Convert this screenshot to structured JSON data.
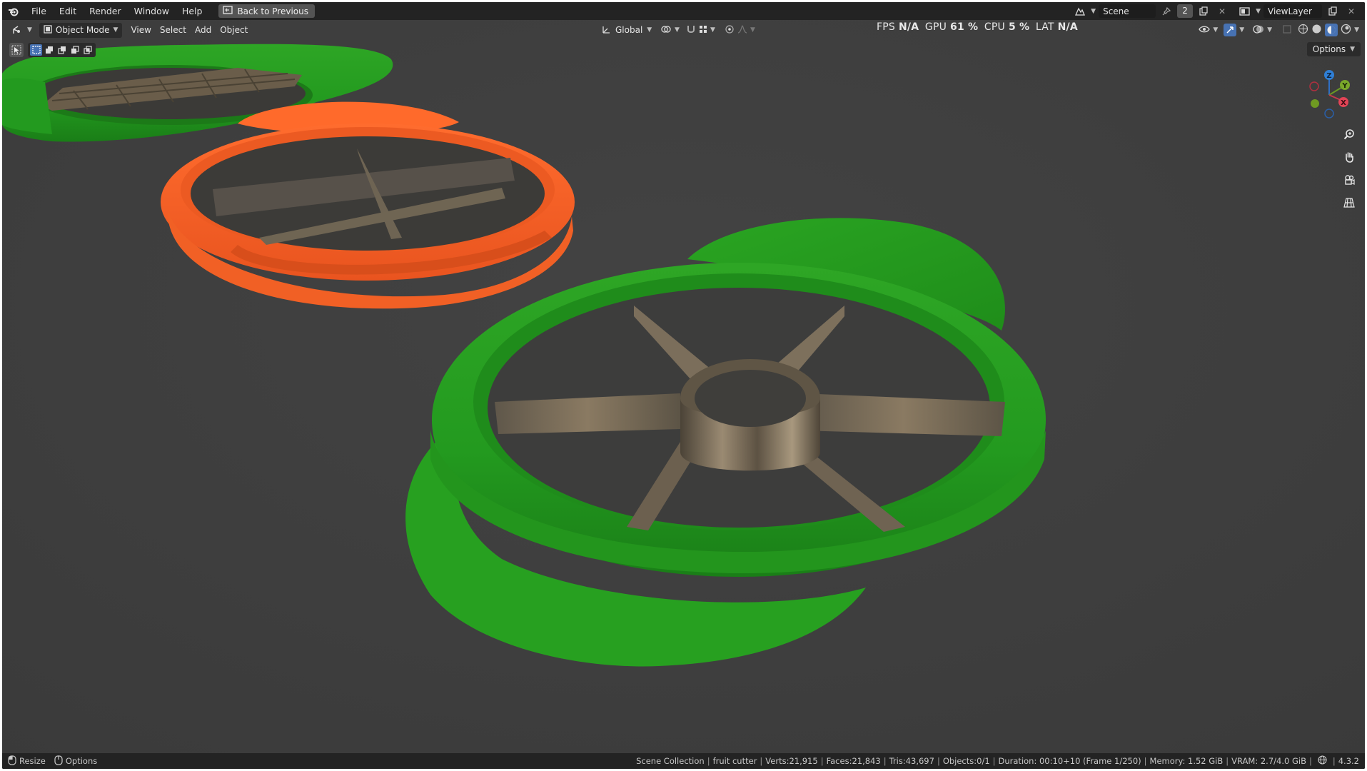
{
  "menu": {
    "items": [
      "File",
      "Edit",
      "Render",
      "Window",
      "Help"
    ],
    "back_button": "Back to Previous"
  },
  "topbar_right": {
    "scene_name": "Scene",
    "scene_users": "2",
    "view_layer": "ViewLayer"
  },
  "viewport_header": {
    "mode": "Object Mode",
    "menus": [
      "View",
      "Select",
      "Add",
      "Object"
    ],
    "orientation": "Global",
    "options_label": "Options"
  },
  "perf_stats": {
    "fps_label": "FPS",
    "fps_value": "N/A",
    "gpu_label": "GPU",
    "gpu_value": "61 %",
    "cpu_label": "CPU",
    "cpu_value": "5 %",
    "lat_label": "LAT",
    "lat_value": "N/A"
  },
  "axes": {
    "z": "Z",
    "y": "Y",
    "x": "X"
  },
  "statusbar": {
    "left": [
      "Resize",
      "Options"
    ],
    "collection": "Scene Collection",
    "object": "fruit cutter",
    "verts": "Verts:21,915",
    "faces": "Faces:21,843",
    "tris": "Tris:43,697",
    "objects": "Objects:0/1",
    "duration": "Duration: 00:10+10 (Frame 1/250)",
    "memory": "Memory: 1.52 GiB",
    "vram": "VRAM: 2.7/4.0 GiB",
    "version": "4.3.2"
  },
  "colors": {
    "background": "#3d3d3d",
    "green_cutter": "#2f9a25",
    "orange_cutter": "#f2622a",
    "blade": "#6e6250",
    "bar": "#232323"
  }
}
